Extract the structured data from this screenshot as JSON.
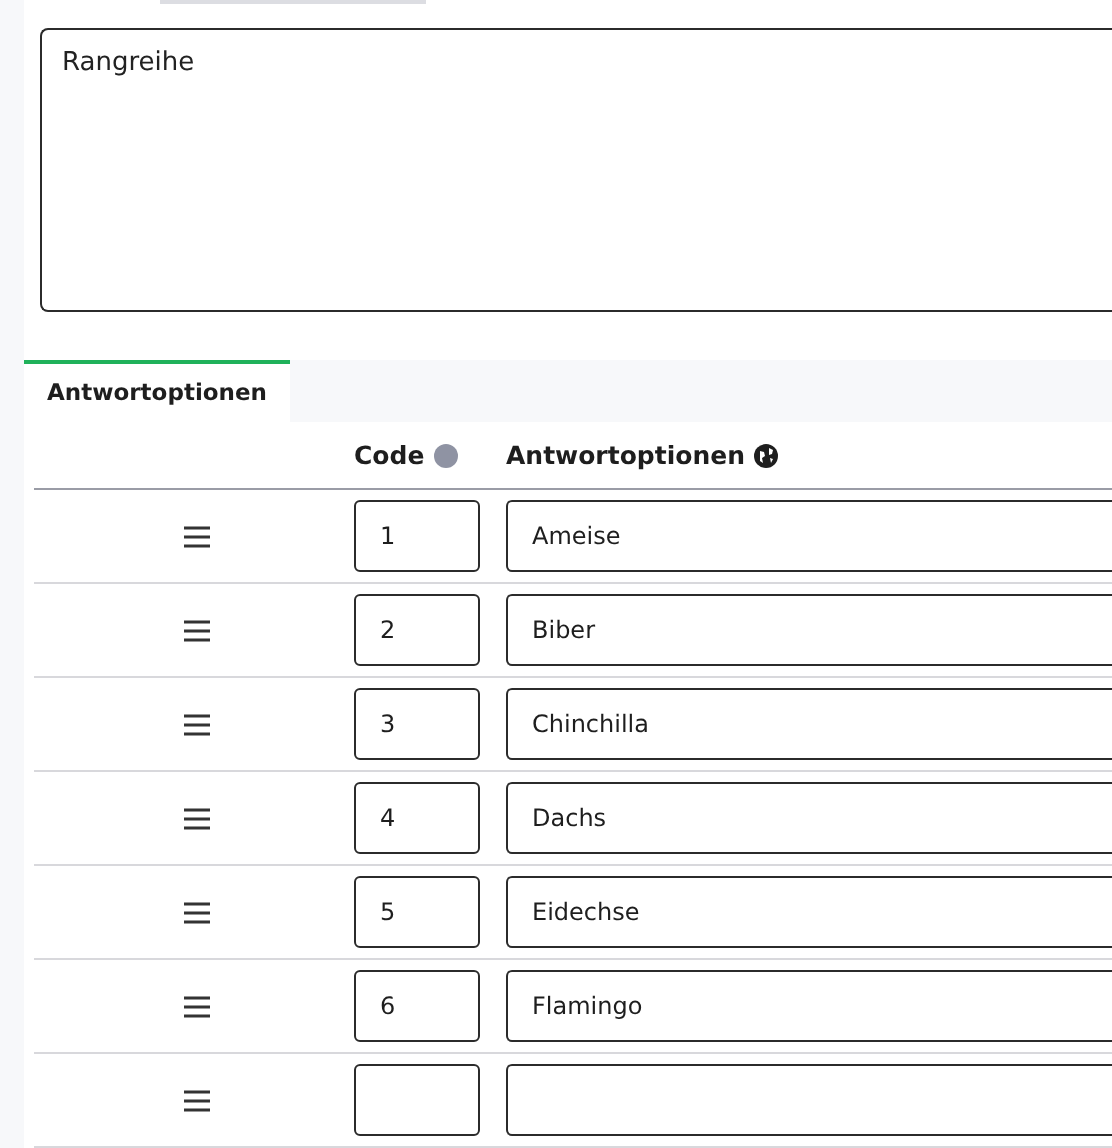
{
  "question": {
    "value": "Rangreihe"
  },
  "tabs": [
    {
      "label": "Antwortoptionen",
      "selected": true
    }
  ],
  "table": {
    "columns": [
      {
        "label": "Code"
      },
      {
        "label": "Antwortoptionen"
      }
    ],
    "rows": [
      {
        "code": "1",
        "option": "Ameise"
      },
      {
        "code": "2",
        "option": "Biber"
      },
      {
        "code": "3",
        "option": "Chinchilla"
      },
      {
        "code": "4",
        "option": "Dachs"
      },
      {
        "code": "5",
        "option": "Eidechse"
      },
      {
        "code": "6",
        "option": "Flamingo"
      },
      {}
    ]
  }
}
